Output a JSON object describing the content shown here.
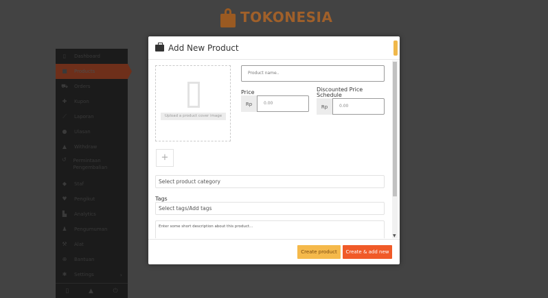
{
  "brand": {
    "name": "TOKONESIA",
    "color": "#a0602a"
  },
  "sidebar": {
    "items": [
      {
        "label": "Dashboard",
        "icon": "mobile-icon"
      },
      {
        "label": "Products",
        "icon": "briefcase-icon",
        "active": true
      },
      {
        "label": "Orders",
        "icon": "cart-icon"
      },
      {
        "label": "Kupon",
        "icon": "gift-icon"
      },
      {
        "label": "Laporan",
        "icon": "chart-icon"
      },
      {
        "label": "Ulasan",
        "icon": "comments-icon"
      },
      {
        "label": "Withdraw",
        "icon": "upload-icon"
      },
      {
        "label": "Permintaan Pengembalian",
        "icon": "undo-icon"
      },
      {
        "label": "Staf",
        "icon": "users-icon"
      },
      {
        "label": "Pengikut",
        "icon": "heart-icon"
      },
      {
        "label": "Analytics",
        "icon": "analytics-icon"
      },
      {
        "label": "Pengumuman",
        "icon": "bell-icon"
      },
      {
        "label": "Alat",
        "icon": "wrench-icon"
      },
      {
        "label": "Bantuan",
        "icon": "lifebuoy-icon"
      },
      {
        "label": "Settings",
        "icon": "gear-icon",
        "arrow": "›"
      }
    ],
    "footer_icons": [
      "mobile-icon",
      "user-icon",
      "power-icon"
    ]
  },
  "modal": {
    "title": "Add New Product",
    "cover_label": "Upload a product cover image",
    "product_name_placeholder": "Product name..",
    "price_label": "Price",
    "price_currency": "Rp",
    "price_placeholder": "0.00",
    "discount_label": "Discounted Price",
    "discount_schedule_label": "Schedule",
    "discount_currency": "Rp",
    "discount_placeholder": "0.00",
    "add_image": "+",
    "category_placeholder": "Select product category",
    "tags_label": "Tags",
    "tags_placeholder": "Select tags/Add tags",
    "description_placeholder": "Enter some short description about this product...",
    "create_label": "Create product",
    "create_add_label": "Create & add new"
  },
  "colors": {
    "accent_orange": "#f05a28",
    "accent_yellow": "#f5b94b",
    "sidebar_bg": "#1b1b1b",
    "overlay": "#434343"
  }
}
